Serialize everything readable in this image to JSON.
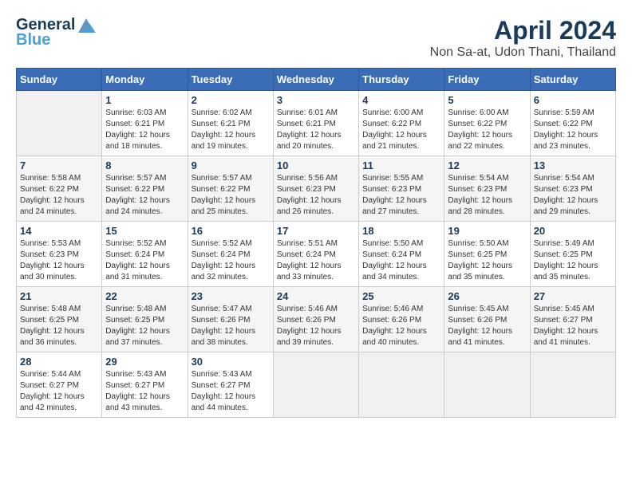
{
  "logo": {
    "line1": "General",
    "line2": "Blue"
  },
  "title": "April 2024",
  "subtitle": "Non Sa-at, Udon Thani, Thailand",
  "headers": [
    "Sunday",
    "Monday",
    "Tuesday",
    "Wednesday",
    "Thursday",
    "Friday",
    "Saturday"
  ],
  "weeks": [
    [
      {
        "day": "",
        "sunrise": "",
        "sunset": "",
        "daylight": ""
      },
      {
        "day": "1",
        "sunrise": "Sunrise: 6:03 AM",
        "sunset": "Sunset: 6:21 PM",
        "daylight": "Daylight: 12 hours and 18 minutes."
      },
      {
        "day": "2",
        "sunrise": "Sunrise: 6:02 AM",
        "sunset": "Sunset: 6:21 PM",
        "daylight": "Daylight: 12 hours and 19 minutes."
      },
      {
        "day": "3",
        "sunrise": "Sunrise: 6:01 AM",
        "sunset": "Sunset: 6:21 PM",
        "daylight": "Daylight: 12 hours and 20 minutes."
      },
      {
        "day": "4",
        "sunrise": "Sunrise: 6:00 AM",
        "sunset": "Sunset: 6:22 PM",
        "daylight": "Daylight: 12 hours and 21 minutes."
      },
      {
        "day": "5",
        "sunrise": "Sunrise: 6:00 AM",
        "sunset": "Sunset: 6:22 PM",
        "daylight": "Daylight: 12 hours and 22 minutes."
      },
      {
        "day": "6",
        "sunrise": "Sunrise: 5:59 AM",
        "sunset": "Sunset: 6:22 PM",
        "daylight": "Daylight: 12 hours and 23 minutes."
      }
    ],
    [
      {
        "day": "7",
        "sunrise": "Sunrise: 5:58 AM",
        "sunset": "Sunset: 6:22 PM",
        "daylight": "Daylight: 12 hours and 24 minutes."
      },
      {
        "day": "8",
        "sunrise": "Sunrise: 5:57 AM",
        "sunset": "Sunset: 6:22 PM",
        "daylight": "Daylight: 12 hours and 24 minutes."
      },
      {
        "day": "9",
        "sunrise": "Sunrise: 5:57 AM",
        "sunset": "Sunset: 6:22 PM",
        "daylight": "Daylight: 12 hours and 25 minutes."
      },
      {
        "day": "10",
        "sunrise": "Sunrise: 5:56 AM",
        "sunset": "Sunset: 6:23 PM",
        "daylight": "Daylight: 12 hours and 26 minutes."
      },
      {
        "day": "11",
        "sunrise": "Sunrise: 5:55 AM",
        "sunset": "Sunset: 6:23 PM",
        "daylight": "Daylight: 12 hours and 27 minutes."
      },
      {
        "day": "12",
        "sunrise": "Sunrise: 5:54 AM",
        "sunset": "Sunset: 6:23 PM",
        "daylight": "Daylight: 12 hours and 28 minutes."
      },
      {
        "day": "13",
        "sunrise": "Sunrise: 5:54 AM",
        "sunset": "Sunset: 6:23 PM",
        "daylight": "Daylight: 12 hours and 29 minutes."
      }
    ],
    [
      {
        "day": "14",
        "sunrise": "Sunrise: 5:53 AM",
        "sunset": "Sunset: 6:23 PM",
        "daylight": "Daylight: 12 hours and 30 minutes."
      },
      {
        "day": "15",
        "sunrise": "Sunrise: 5:52 AM",
        "sunset": "Sunset: 6:24 PM",
        "daylight": "Daylight: 12 hours and 31 minutes."
      },
      {
        "day": "16",
        "sunrise": "Sunrise: 5:52 AM",
        "sunset": "Sunset: 6:24 PM",
        "daylight": "Daylight: 12 hours and 32 minutes."
      },
      {
        "day": "17",
        "sunrise": "Sunrise: 5:51 AM",
        "sunset": "Sunset: 6:24 PM",
        "daylight": "Daylight: 12 hours and 33 minutes."
      },
      {
        "day": "18",
        "sunrise": "Sunrise: 5:50 AM",
        "sunset": "Sunset: 6:24 PM",
        "daylight": "Daylight: 12 hours and 34 minutes."
      },
      {
        "day": "19",
        "sunrise": "Sunrise: 5:50 AM",
        "sunset": "Sunset: 6:25 PM",
        "daylight": "Daylight: 12 hours and 35 minutes."
      },
      {
        "day": "20",
        "sunrise": "Sunrise: 5:49 AM",
        "sunset": "Sunset: 6:25 PM",
        "daylight": "Daylight: 12 hours and 35 minutes."
      }
    ],
    [
      {
        "day": "21",
        "sunrise": "Sunrise: 5:48 AM",
        "sunset": "Sunset: 6:25 PM",
        "daylight": "Daylight: 12 hours and 36 minutes."
      },
      {
        "day": "22",
        "sunrise": "Sunrise: 5:48 AM",
        "sunset": "Sunset: 6:25 PM",
        "daylight": "Daylight: 12 hours and 37 minutes."
      },
      {
        "day": "23",
        "sunrise": "Sunrise: 5:47 AM",
        "sunset": "Sunset: 6:26 PM",
        "daylight": "Daylight: 12 hours and 38 minutes."
      },
      {
        "day": "24",
        "sunrise": "Sunrise: 5:46 AM",
        "sunset": "Sunset: 6:26 PM",
        "daylight": "Daylight: 12 hours and 39 minutes."
      },
      {
        "day": "25",
        "sunrise": "Sunrise: 5:46 AM",
        "sunset": "Sunset: 6:26 PM",
        "daylight": "Daylight: 12 hours and 40 minutes."
      },
      {
        "day": "26",
        "sunrise": "Sunrise: 5:45 AM",
        "sunset": "Sunset: 6:26 PM",
        "daylight": "Daylight: 12 hours and 41 minutes."
      },
      {
        "day": "27",
        "sunrise": "Sunrise: 5:45 AM",
        "sunset": "Sunset: 6:27 PM",
        "daylight": "Daylight: 12 hours and 41 minutes."
      }
    ],
    [
      {
        "day": "28",
        "sunrise": "Sunrise: 5:44 AM",
        "sunset": "Sunset: 6:27 PM",
        "daylight": "Daylight: 12 hours and 42 minutes."
      },
      {
        "day": "29",
        "sunrise": "Sunrise: 5:43 AM",
        "sunset": "Sunset: 6:27 PM",
        "daylight": "Daylight: 12 hours and 43 minutes."
      },
      {
        "day": "30",
        "sunrise": "Sunrise: 5:43 AM",
        "sunset": "Sunset: 6:27 PM",
        "daylight": "Daylight: 12 hours and 44 minutes."
      },
      {
        "day": "",
        "sunrise": "",
        "sunset": "",
        "daylight": ""
      },
      {
        "day": "",
        "sunrise": "",
        "sunset": "",
        "daylight": ""
      },
      {
        "day": "",
        "sunrise": "",
        "sunset": "",
        "daylight": ""
      },
      {
        "day": "",
        "sunrise": "",
        "sunset": "",
        "daylight": ""
      }
    ]
  ]
}
